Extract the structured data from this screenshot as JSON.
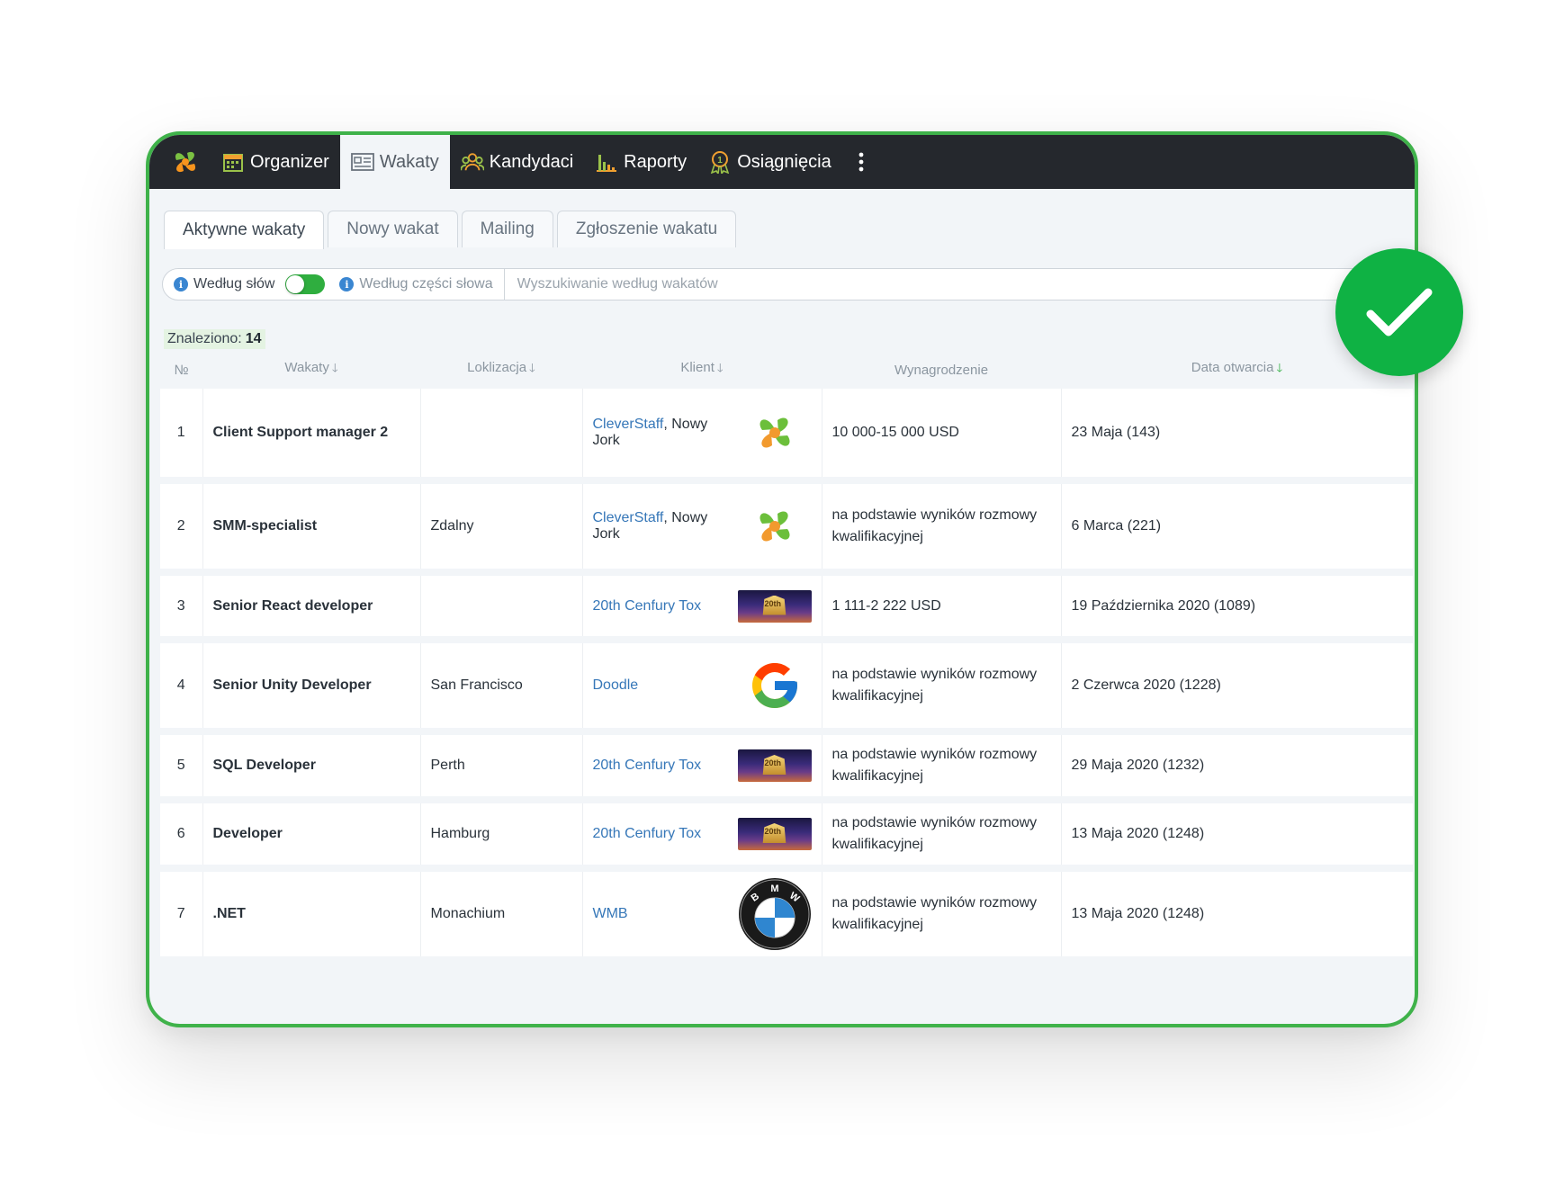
{
  "nav": {
    "items": [
      {
        "label": "Organizer",
        "icon": "calendar-icon",
        "active": false
      },
      {
        "label": "Wakaty",
        "icon": "vacancy-card-icon",
        "active": true
      },
      {
        "label": "Kandydaci",
        "icon": "people-icon",
        "active": false
      },
      {
        "label": "Raporty",
        "icon": "bar-chart-icon",
        "active": false
      },
      {
        "label": "Osiągnięcia",
        "icon": "medal-icon",
        "active": false
      }
    ]
  },
  "subtabs": [
    {
      "label": "Aktywne wakaty",
      "active": true
    },
    {
      "label": "Nowy wakat",
      "active": false
    },
    {
      "label": "Mailing",
      "active": false
    },
    {
      "label": "Zgłoszenie wakatu",
      "active": false
    }
  ],
  "search": {
    "by_words": "Według słów",
    "by_part": "Według części słowa",
    "placeholder": "Wyszukiwanie według wakatów"
  },
  "found": {
    "label": "Znaleziono:",
    "count": "14"
  },
  "table": {
    "headers": {
      "num": "№",
      "position": "Wakaty",
      "location": "Loklizacja",
      "client": "Klient",
      "salary": "Wynagrodzenie",
      "date": "Data otwarcia"
    },
    "rows": [
      {
        "num": "1",
        "position": "Client Support manager 2",
        "location": "",
        "client": "CleverStaff",
        "city": ", Nowy Jork",
        "logo": "cleverstaff-logo",
        "salary": "10 000-15 000 USD",
        "date": "23 Maja (143)"
      },
      {
        "num": "2",
        "position": "SMM-specialist",
        "location": "Zdalny",
        "client": "CleverStaff",
        "city": ", Nowy Jork",
        "logo": "cleverstaff-logo",
        "salary": "na podstawie wyników rozmowy kwalifikacyjnej",
        "date": "6 Marca (221)"
      },
      {
        "num": "3",
        "position": "Senior React developer",
        "location": "",
        "client": "20th Cenfury Tox",
        "city": "",
        "logo": "fox-logo",
        "salary": "1 111-2 222 USD",
        "date": "19 Października 2020 (1089)"
      },
      {
        "num": "4",
        "position": "Senior Unity Developer",
        "location": "San Francisco",
        "client": "Doodle",
        "city": "",
        "logo": "google-logo",
        "salary": "na podstawie wyników rozmowy kwalifikacyjnej",
        "date": "2 Czerwca 2020 (1228)"
      },
      {
        "num": "5",
        "position": "SQL Developer",
        "location": "Perth",
        "client": "20th Cenfury Tox",
        "city": "",
        "logo": "fox-logo",
        "salary": "na podstawie wyników rozmowy kwalifikacyjnej",
        "date": "29 Maja 2020 (1232)"
      },
      {
        "num": "6",
        "position": "Developer",
        "location": "Hamburg",
        "client": "20th Cenfury Tox",
        "city": "",
        "logo": "fox-logo",
        "salary": "na podstawie wyników rozmowy kwalifikacyjnej",
        "date": "13 Maja 2020 (1248)"
      },
      {
        "num": "7",
        "position": ".NET",
        "location": "Monachium",
        "client": "WMB",
        "city": "",
        "logo": "bmw-logo",
        "salary": "na podstawie wyników rozmowy kwalifikacyjnej",
        "date": "13 Maja 2020 (1248)"
      }
    ]
  },
  "colors": {
    "accent_green": "#2fae3f",
    "nav_bg": "#25282d",
    "link_blue": "#3677b8",
    "badge_green": "#0fb244"
  }
}
